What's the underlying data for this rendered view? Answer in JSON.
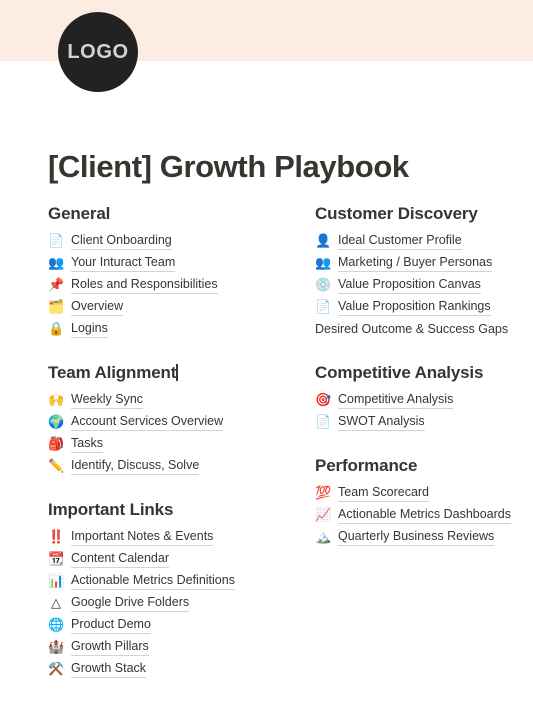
{
  "cover": {
    "band_color": "#fcece1",
    "logo_text": "LOGO",
    "logo_bg": "#222222"
  },
  "page_title": "[Client] Growth Playbook",
  "editing_caret_section": "Team Alignment",
  "columns": {
    "left": [
      {
        "heading": "General",
        "has_caret": false,
        "items": [
          {
            "icon": "page-icon",
            "glyph": "📄",
            "label": "Client Onboarding",
            "link": true
          },
          {
            "icon": "two-people-icon",
            "glyph": "👥",
            "label": "Your Inturact Team",
            "link": true
          },
          {
            "icon": "pushpin-icon",
            "glyph": "📌",
            "label": "Roles and Responsibilities",
            "link": true
          },
          {
            "icon": "folder-icon",
            "glyph": "🗂️",
            "label": "Overview",
            "link": true
          },
          {
            "icon": "lock-icon",
            "glyph": "🔒",
            "label": "Logins",
            "link": true
          }
        ]
      },
      {
        "heading": "Team Alignment",
        "has_caret": true,
        "items": [
          {
            "icon": "raised-hands-icon",
            "glyph": "🙌",
            "label": "Weekly Sync",
            "link": true
          },
          {
            "icon": "globe-icon",
            "glyph": "🌍",
            "label": "Account Services Overview",
            "link": true
          },
          {
            "icon": "red-sack-icon",
            "glyph": "🎒",
            "label": "Tasks",
            "link": true
          },
          {
            "icon": "pencil-icon",
            "glyph": "✏️",
            "label": "Identify, Discuss, Solve",
            "link": true
          }
        ]
      },
      {
        "heading": "Important Links",
        "has_caret": false,
        "items": [
          {
            "icon": "double-exclamation-icon",
            "glyph": "‼️",
            "label": "Important Notes & Events",
            "link": true
          },
          {
            "icon": "calendar-icon",
            "glyph": "📆",
            "label": "Content Calendar",
            "link": true
          },
          {
            "icon": "bar-chart-icon",
            "glyph": "📊",
            "label": "Actionable Metrics Definitions",
            "link": true
          },
          {
            "icon": "google-drive-icon",
            "glyph": "△",
            "label": "Google Drive Folders",
            "link": true
          },
          {
            "icon": "globe-meridians-icon",
            "glyph": "🌐",
            "label": "Product Demo",
            "link": true
          },
          {
            "icon": "castle-icon",
            "glyph": "🏰",
            "label": "Growth Pillars",
            "link": true
          },
          {
            "icon": "hammer-and-wrench-icon",
            "glyph": "⚒️",
            "label": "Growth Stack",
            "link": true
          }
        ]
      }
    ],
    "right": [
      {
        "heading": "Customer Discovery",
        "has_caret": false,
        "items": [
          {
            "icon": "person-silhouette-icon",
            "glyph": "👤",
            "label": "Ideal Customer Profile",
            "link": true
          },
          {
            "icon": "two-people-icon",
            "glyph": "👥",
            "label": "Marketing / Buyer Personas",
            "link": true
          },
          {
            "icon": "compass-disc-icon",
            "glyph": "💿",
            "label": "Value Proposition Canvas",
            "link": true
          },
          {
            "icon": "page-icon",
            "glyph": "📄",
            "label": "Value Proposition Rankings",
            "link": true
          },
          {
            "icon": "none",
            "glyph": "",
            "label": "Desired Outcome & Success Gaps",
            "link": false
          }
        ]
      },
      {
        "heading": "Competitive Analysis",
        "has_caret": false,
        "items": [
          {
            "icon": "dart-target-icon",
            "glyph": "🎯",
            "label": "Competitive Analysis",
            "link": true
          },
          {
            "icon": "page-icon",
            "glyph": "📄",
            "label": "SWOT Analysis",
            "link": true
          }
        ]
      },
      {
        "heading": "Performance",
        "has_caret": false,
        "items": [
          {
            "icon": "hundred-points-icon",
            "glyph": "💯",
            "label": "Team Scorecard",
            "link": true
          },
          {
            "icon": "chart-increasing-icon",
            "glyph": "📈",
            "label": "Actionable Metrics Dashboards",
            "link": true
          },
          {
            "icon": "mountain-icon",
            "glyph": "🏔️",
            "label": "Quarterly Business Reviews",
            "link": true
          }
        ]
      }
    ]
  }
}
